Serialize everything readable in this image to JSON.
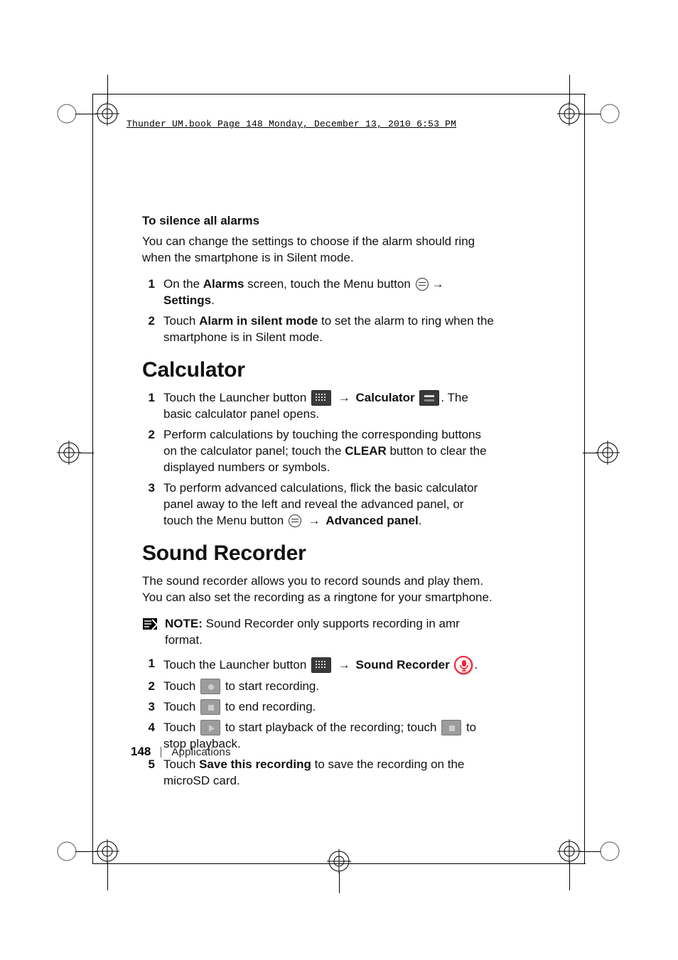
{
  "header": "Thunder_UM.book  Page 148  Monday, December 13, 2010  6:53 PM",
  "sections": {
    "silence": {
      "heading": "To silence all alarms",
      "intro": "You can change the settings to choose if the alarm should ring when the smartphone is in Silent mode.",
      "steps": [
        {
          "pre": "On the ",
          "b1": "Alarms",
          "mid": " screen, touch the Menu button ",
          "arrow": "→",
          "b2": " Settings",
          "post": "."
        },
        {
          "pre": "Touch ",
          "b1": "Alarm in silent mode",
          "post": " to set the alarm to ring when the smartphone is in Silent mode."
        }
      ]
    },
    "calculator": {
      "heading": "Calculator",
      "steps": [
        {
          "pre": "Touch the Launcher button ",
          "arrow": " → ",
          "b1": "Calculator",
          "post1": " ",
          "post2": ". The basic calculator panel opens."
        },
        {
          "pre": "Perform calculations by touching the corresponding buttons on the calculator panel; touch the ",
          "b1": "CLEAR",
          "post": " button to clear the displayed numbers or symbols."
        },
        {
          "pre": "To perform advanced calculations, flick the basic calculator panel away to the left and reveal the advanced panel, or touch the Menu button ",
          "arrow": " → ",
          "b1": "Advanced panel",
          "post": "."
        }
      ]
    },
    "sound": {
      "heading": "Sound Recorder",
      "intro": "The sound recorder allows you to record sounds and play them. You can also set the recording as a ringtone for your smartphone.",
      "note_label": "NOTE:",
      "note": " Sound Recorder only supports recording in amr format.",
      "steps": [
        {
          "pre": "Touch the Launcher button ",
          "arrow": " → ",
          "b1": "Sound Recorder",
          "post": " ",
          "trail": "."
        },
        {
          "pre": "Touch ",
          "post": " to start recording."
        },
        {
          "pre": "Touch ",
          "post": " to end recording."
        },
        {
          "pre": "Touch ",
          "mid": " to start playback of the recording; touch ",
          "post": " to stop playback."
        },
        {
          "pre": "Touch ",
          "b1": "Save this recording",
          "post": " to save the recording on the microSD card."
        }
      ]
    }
  },
  "footer": {
    "page": "148",
    "chapter": "Applications"
  }
}
